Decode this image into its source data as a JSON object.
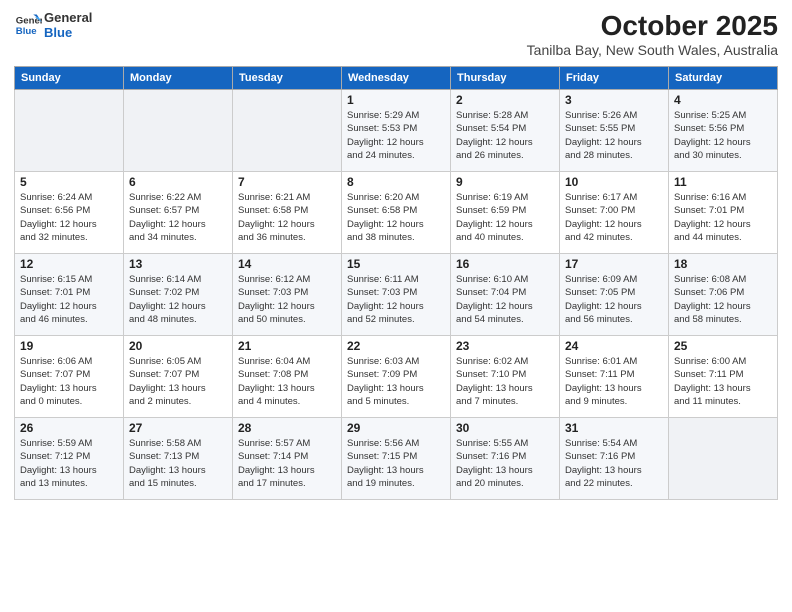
{
  "logo": {
    "line1": "General",
    "line2": "Blue"
  },
  "header": {
    "month": "October 2025",
    "location": "Tanilba Bay, New South Wales, Australia"
  },
  "weekdays": [
    "Sunday",
    "Monday",
    "Tuesday",
    "Wednesday",
    "Thursday",
    "Friday",
    "Saturday"
  ],
  "weeks": [
    [
      {
        "day": "",
        "info": ""
      },
      {
        "day": "",
        "info": ""
      },
      {
        "day": "",
        "info": ""
      },
      {
        "day": "1",
        "info": "Sunrise: 5:29 AM\nSunset: 5:53 PM\nDaylight: 12 hours\nand 24 minutes."
      },
      {
        "day": "2",
        "info": "Sunrise: 5:28 AM\nSunset: 5:54 PM\nDaylight: 12 hours\nand 26 minutes."
      },
      {
        "day": "3",
        "info": "Sunrise: 5:26 AM\nSunset: 5:55 PM\nDaylight: 12 hours\nand 28 minutes."
      },
      {
        "day": "4",
        "info": "Sunrise: 5:25 AM\nSunset: 5:56 PM\nDaylight: 12 hours\nand 30 minutes."
      }
    ],
    [
      {
        "day": "5",
        "info": "Sunrise: 6:24 AM\nSunset: 6:56 PM\nDaylight: 12 hours\nand 32 minutes."
      },
      {
        "day": "6",
        "info": "Sunrise: 6:22 AM\nSunset: 6:57 PM\nDaylight: 12 hours\nand 34 minutes."
      },
      {
        "day": "7",
        "info": "Sunrise: 6:21 AM\nSunset: 6:58 PM\nDaylight: 12 hours\nand 36 minutes."
      },
      {
        "day": "8",
        "info": "Sunrise: 6:20 AM\nSunset: 6:58 PM\nDaylight: 12 hours\nand 38 minutes."
      },
      {
        "day": "9",
        "info": "Sunrise: 6:19 AM\nSunset: 6:59 PM\nDaylight: 12 hours\nand 40 minutes."
      },
      {
        "day": "10",
        "info": "Sunrise: 6:17 AM\nSunset: 7:00 PM\nDaylight: 12 hours\nand 42 minutes."
      },
      {
        "day": "11",
        "info": "Sunrise: 6:16 AM\nSunset: 7:01 PM\nDaylight: 12 hours\nand 44 minutes."
      }
    ],
    [
      {
        "day": "12",
        "info": "Sunrise: 6:15 AM\nSunset: 7:01 PM\nDaylight: 12 hours\nand 46 minutes."
      },
      {
        "day": "13",
        "info": "Sunrise: 6:14 AM\nSunset: 7:02 PM\nDaylight: 12 hours\nand 48 minutes."
      },
      {
        "day": "14",
        "info": "Sunrise: 6:12 AM\nSunset: 7:03 PM\nDaylight: 12 hours\nand 50 minutes."
      },
      {
        "day": "15",
        "info": "Sunrise: 6:11 AM\nSunset: 7:03 PM\nDaylight: 12 hours\nand 52 minutes."
      },
      {
        "day": "16",
        "info": "Sunrise: 6:10 AM\nSunset: 7:04 PM\nDaylight: 12 hours\nand 54 minutes."
      },
      {
        "day": "17",
        "info": "Sunrise: 6:09 AM\nSunset: 7:05 PM\nDaylight: 12 hours\nand 56 minutes."
      },
      {
        "day": "18",
        "info": "Sunrise: 6:08 AM\nSunset: 7:06 PM\nDaylight: 12 hours\nand 58 minutes."
      }
    ],
    [
      {
        "day": "19",
        "info": "Sunrise: 6:06 AM\nSunset: 7:07 PM\nDaylight: 13 hours\nand 0 minutes."
      },
      {
        "day": "20",
        "info": "Sunrise: 6:05 AM\nSunset: 7:07 PM\nDaylight: 13 hours\nand 2 minutes."
      },
      {
        "day": "21",
        "info": "Sunrise: 6:04 AM\nSunset: 7:08 PM\nDaylight: 13 hours\nand 4 minutes."
      },
      {
        "day": "22",
        "info": "Sunrise: 6:03 AM\nSunset: 7:09 PM\nDaylight: 13 hours\nand 5 minutes."
      },
      {
        "day": "23",
        "info": "Sunrise: 6:02 AM\nSunset: 7:10 PM\nDaylight: 13 hours\nand 7 minutes."
      },
      {
        "day": "24",
        "info": "Sunrise: 6:01 AM\nSunset: 7:11 PM\nDaylight: 13 hours\nand 9 minutes."
      },
      {
        "day": "25",
        "info": "Sunrise: 6:00 AM\nSunset: 7:11 PM\nDaylight: 13 hours\nand 11 minutes."
      }
    ],
    [
      {
        "day": "26",
        "info": "Sunrise: 5:59 AM\nSunset: 7:12 PM\nDaylight: 13 hours\nand 13 minutes."
      },
      {
        "day": "27",
        "info": "Sunrise: 5:58 AM\nSunset: 7:13 PM\nDaylight: 13 hours\nand 15 minutes."
      },
      {
        "day": "28",
        "info": "Sunrise: 5:57 AM\nSunset: 7:14 PM\nDaylight: 13 hours\nand 17 minutes."
      },
      {
        "day": "29",
        "info": "Sunrise: 5:56 AM\nSunset: 7:15 PM\nDaylight: 13 hours\nand 19 minutes."
      },
      {
        "day": "30",
        "info": "Sunrise: 5:55 AM\nSunset: 7:16 PM\nDaylight: 13 hours\nand 20 minutes."
      },
      {
        "day": "31",
        "info": "Sunrise: 5:54 AM\nSunset: 7:16 PM\nDaylight: 13 hours\nand 22 minutes."
      },
      {
        "day": "",
        "info": ""
      }
    ]
  ]
}
